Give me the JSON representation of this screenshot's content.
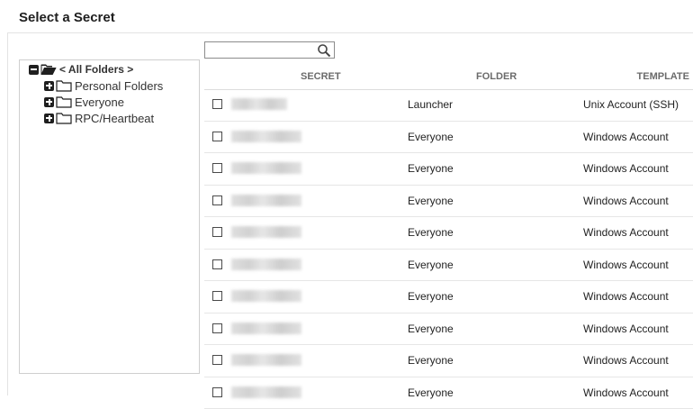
{
  "page": {
    "title": "Select a Secret"
  },
  "tree": {
    "root_label": "< All Folders >",
    "items": [
      {
        "label": "Personal Folders"
      },
      {
        "label": "Everyone"
      },
      {
        "label": "RPC/Heartbeat"
      }
    ]
  },
  "search": {
    "value": "",
    "placeholder": ""
  },
  "table": {
    "columns": {
      "secret": "SECRET",
      "folder": "FOLDER",
      "template": "TEMPLATE"
    },
    "rows": [
      {
        "folder": "Launcher",
        "template": "Unix Account (SSH)",
        "checked": false
      },
      {
        "folder": "Everyone",
        "template": "Windows Account",
        "checked": false
      },
      {
        "folder": "Everyone",
        "template": "Windows Account",
        "checked": false
      },
      {
        "folder": "Everyone",
        "template": "Windows Account",
        "checked": false
      },
      {
        "folder": "Everyone",
        "template": "Windows Account",
        "checked": false
      },
      {
        "folder": "Everyone",
        "template": "Windows Account",
        "checked": false
      },
      {
        "folder": "Everyone",
        "template": "Windows Account",
        "checked": false
      },
      {
        "folder": "Everyone",
        "template": "Windows Account",
        "checked": false
      },
      {
        "folder": "Everyone",
        "template": "Windows Account",
        "checked": false
      },
      {
        "folder": "Everyone",
        "template": "Windows Account",
        "checked": false
      }
    ]
  },
  "icons": {
    "search": "search-icon",
    "folder": "folder-icon",
    "folder_open": "folder-open-icon",
    "expand": "plus-box-icon",
    "collapse": "minus-box-icon"
  }
}
